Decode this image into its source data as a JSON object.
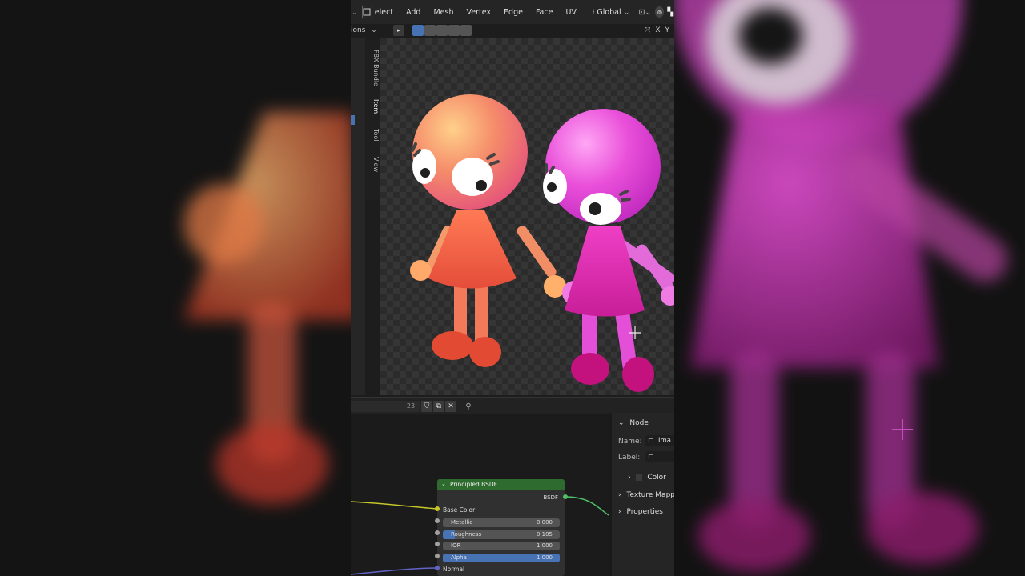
{
  "toolbar": {
    "menu_select": "elect",
    "menu_add": "Add",
    "menu_mesh": "Mesh",
    "menu_vertex": "Vertex",
    "menu_edge": "Edge",
    "menu_face": "Face",
    "menu_uv": "UV",
    "orientation": "Global"
  },
  "toolbar2": {
    "options_label": "ions",
    "axis_x": "X",
    "axis_y": "Y"
  },
  "side_tabs": [
    "FBX Bundle",
    "Item",
    "Tool",
    "View"
  ],
  "node_editor": {
    "header_number": "23",
    "node_panel": {
      "title": "Node",
      "name_label": "Name:",
      "name_value": "Ima",
      "label_label": "Label:",
      "color_label": "Color",
      "texture_mapping": "Texture Mapp",
      "properties": "Properties"
    },
    "bsdf_node": {
      "title": "Principled BSDF",
      "output": "BSDF",
      "base_color": "Base Color",
      "metallic_label": "Metallic",
      "metallic_value": "0.000",
      "roughness_label": "Roughness",
      "roughness_value": "0.105",
      "roughness_fill": 0.105,
      "ior_label": "IOR",
      "ior_value": "1.000",
      "alpha_label": "Alpha",
      "alpha_value": "1.000",
      "normal_label": "Normal"
    }
  },
  "colors": {
    "character_left": "#f0624a",
    "character_right": "#e52fc9",
    "node_header": "#2e6b2e",
    "accent_blue": "#4772b3"
  }
}
